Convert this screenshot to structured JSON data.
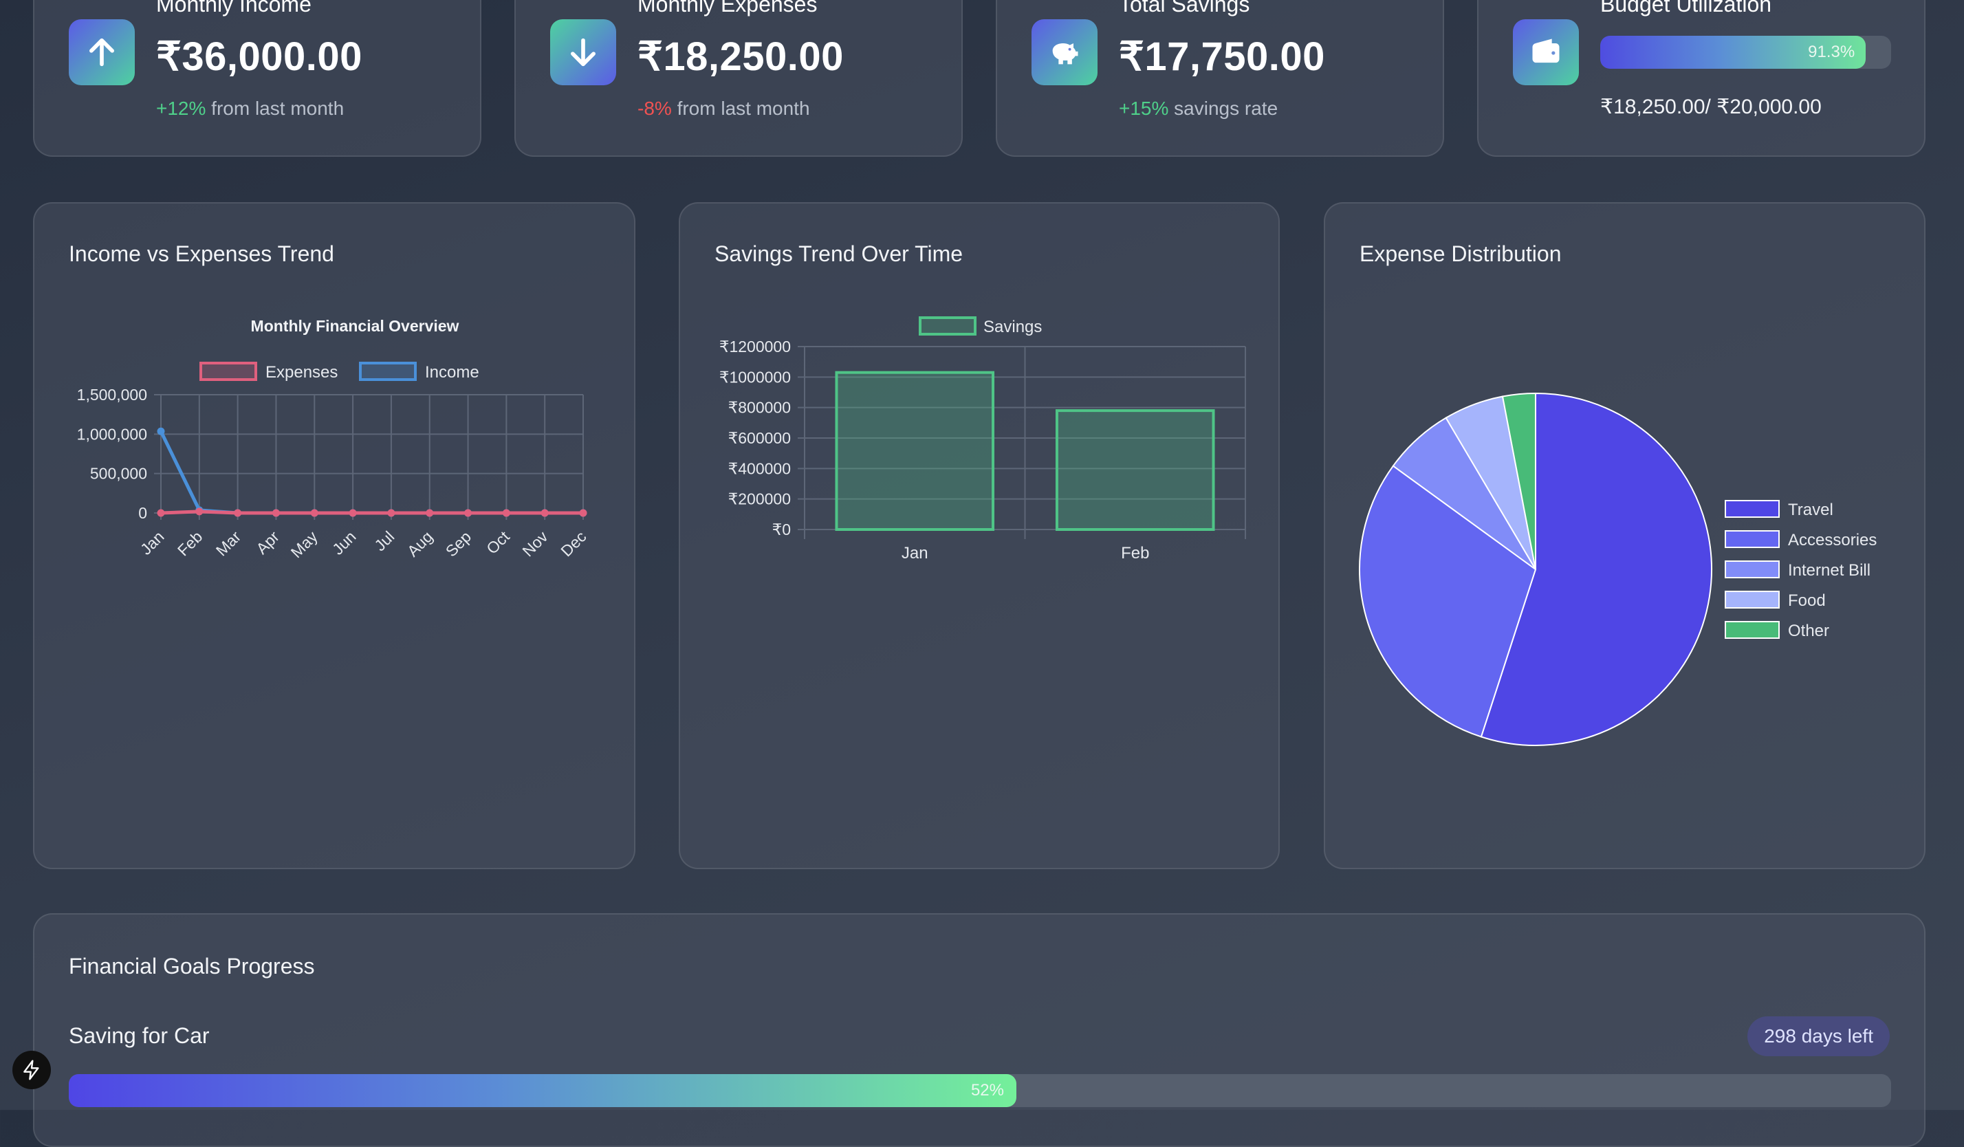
{
  "stats": {
    "income": {
      "label": "Monthly Income",
      "value": "₹36,000.00",
      "delta": "+12%",
      "delta_text": " from last month",
      "icon": "arrow-up-icon"
    },
    "expenses": {
      "label": "Monthly Expenses",
      "value": "₹18,250.00",
      "delta": "-8%",
      "delta_text": " from last month",
      "icon": "arrow-down-icon"
    },
    "savings": {
      "label": "Total Savings",
      "value": "₹17,750.00",
      "delta": "+15%",
      "delta_text": " savings rate",
      "icon": "piggy-bank-icon"
    },
    "budget": {
      "label": "Budget Utilization",
      "percent_label": "91.3%",
      "percent": 91.3,
      "amount": "₹18,250.00/ ₹20,000.00",
      "icon": "wallet-icon"
    }
  },
  "panels": {
    "income_expenses": {
      "title": "Income vs Expenses Trend"
    },
    "savings_trend": {
      "title": "Savings Trend Over Time"
    },
    "expense_distribution": {
      "title": "Expense Distribution"
    }
  },
  "chart_data": [
    {
      "type": "line",
      "title": "Monthly Financial Overview",
      "categories": [
        "Jan",
        "Feb",
        "Mar",
        "Apr",
        "May",
        "Jun",
        "Jul",
        "Aug",
        "Sep",
        "Oct",
        "Nov",
        "Dec"
      ],
      "series": [
        {
          "name": "Expenses",
          "color": "#e0607e",
          "values": [
            0,
            18250,
            0,
            0,
            0,
            0,
            0,
            0,
            0,
            0,
            0,
            0
          ]
        },
        {
          "name": "Income",
          "color": "#4a90d9",
          "values": [
            1036000,
            36000,
            0,
            0,
            0,
            0,
            0,
            0,
            0,
            0,
            0,
            0
          ]
        }
      ],
      "yticks": [
        "0",
        "500,000",
        "1,000,000",
        "1,500,000"
      ],
      "ylim": [
        0,
        1500000
      ],
      "legend": "top",
      "grid": true
    },
    {
      "type": "bar",
      "categories": [
        "Jan",
        "Feb"
      ],
      "series": [
        {
          "name": "Savings",
          "color": "#4fc487",
          "values": [
            1030000,
            780000
          ]
        }
      ],
      "yticks": [
        "₹0",
        "₹200000",
        "₹400000",
        "₹600000",
        "₹800000",
        "₹1000000",
        "₹1200000"
      ],
      "ylim": [
        0,
        1200000
      ],
      "legend": "top",
      "grid": true
    },
    {
      "type": "pie",
      "labels": [
        "Travel",
        "Accessories",
        "Internet Bill",
        "Food",
        "Other"
      ],
      "values": [
        55,
        30,
        6.5,
        5.5,
        3
      ],
      "colors": [
        "#4f46e5",
        "#6366f1",
        "#818cf8",
        "#a5b4fc",
        "#48bb78"
      ],
      "legend": "right"
    }
  ],
  "goals": {
    "title": "Financial Goals Progress",
    "items": [
      {
        "name": "Saving for Car",
        "days_left": "298 days left",
        "percent_label": "52%",
        "percent": 52
      }
    ]
  },
  "fab": {
    "icon": "lightning-icon"
  }
}
